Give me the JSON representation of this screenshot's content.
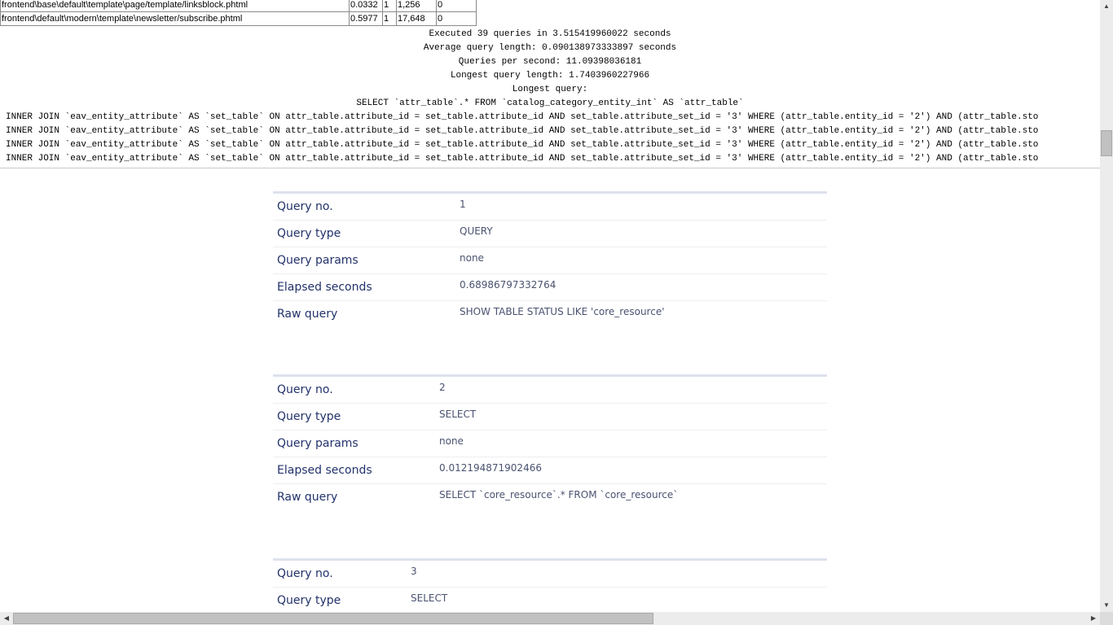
{
  "template_rows": [
    {
      "file": "frontend\\base\\default\\template\\page/template/linksblock.phtml",
      "time": "0.0332",
      "count": "1",
      "mem": "1,256",
      "extra": "0"
    },
    {
      "file": "frontend\\default\\modern\\template\\newsletter/subscribe.phtml",
      "time": "0.5977",
      "count": "1",
      "mem": "17,648",
      "extra": "0"
    }
  ],
  "stats": {
    "executed": "Executed 39 queries in 3.515419960022 seconds",
    "avg": "Average query length: 0.090138973333897 seconds",
    "qps": "Queries per second: 11.09398036181",
    "longest_len": "Longest query length: 1.7403960227966",
    "longest_label": "Longest query:",
    "longest_select": "SELECT `attr_table`.* FROM `catalog_category_entity_int` AS `attr_table`"
  },
  "join_lines": [
    "INNER JOIN `eav_entity_attribute` AS `set_table` ON attr_table.attribute_id = set_table.attribute_id AND set_table.attribute_set_id = '3' WHERE (attr_table.entity_id = '2') AND (attr_table.sto",
    "INNER JOIN `eav_entity_attribute` AS `set_table` ON attr_table.attribute_id = set_table.attribute_id AND set_table.attribute_set_id = '3' WHERE (attr_table.entity_id = '2') AND (attr_table.sto",
    "INNER JOIN `eav_entity_attribute` AS `set_table` ON attr_table.attribute_id = set_table.attribute_id AND set_table.attribute_set_id = '3' WHERE (attr_table.entity_id = '2') AND (attr_table.sto",
    "INNER JOIN `eav_entity_attribute` AS `set_table` ON attr_table.attribute_id = set_table.attribute_id AND set_table.attribute_set_id = '3' WHERE (attr_table.entity_id = '2') AND (attr_table.sto"
  ],
  "labels": {
    "query_no": "Query no.",
    "query_type": "Query type",
    "query_params": "Query params",
    "elapsed": "Elapsed seconds",
    "raw": "Raw query"
  },
  "queries": [
    {
      "no": "1",
      "type": "QUERY",
      "params": "none",
      "elapsed": "0.68986797332764",
      "raw": "SHOW TABLE STATUS LIKE 'core_resource'"
    },
    {
      "no": "2",
      "type": "SELECT",
      "params": "none",
      "elapsed": "0.012194871902466",
      "raw": "SELECT `core_resource`.* FROM `core_resource`"
    },
    {
      "no": "3",
      "type": "SELECT"
    }
  ],
  "scroll_icons": {
    "up": "scroll-up-arrow",
    "down": "scroll-down-arrow",
    "left": "scroll-left-arrow",
    "right": "scroll-right-arrow"
  }
}
